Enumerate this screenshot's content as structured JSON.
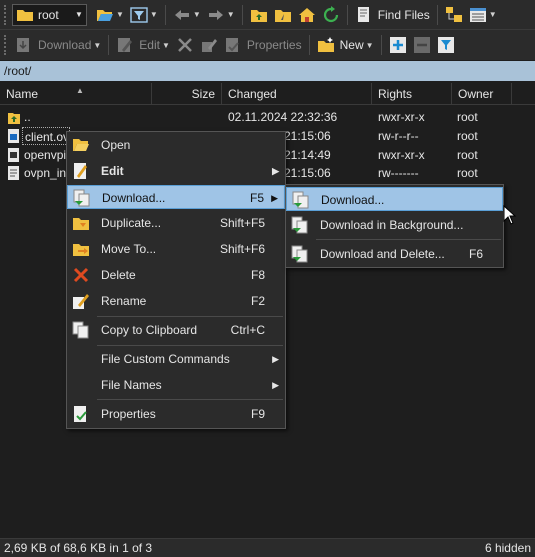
{
  "toolbar1": {
    "location": "root",
    "find_files": "Find Files"
  },
  "toolbar2": {
    "download": "Download",
    "edit": "Edit",
    "properties": "Properties",
    "new": "New"
  },
  "path": "/root/",
  "columns": {
    "name": "Name",
    "size": "Size",
    "changed": "Changed",
    "rights": "Rights",
    "owner": "Owner"
  },
  "files": [
    {
      "name": "..",
      "size": "",
      "changed": "02.11.2024 22:32:36",
      "rights": "rwxr-xr-x",
      "owner": "root"
    },
    {
      "name": "client.ov",
      "size": "",
      "changed": "21:15:06",
      "rights": "rw-r--r--",
      "owner": "root"
    },
    {
      "name": "openvpi",
      "size": "",
      "changed": "21:14:49",
      "rights": "rwxr-xr-x",
      "owner": "root"
    },
    {
      "name": "ovpn_in",
      "size": "",
      "changed": "21:15:06",
      "rights": "rw-------",
      "owner": "root"
    }
  ],
  "context_menu": {
    "open": "Open",
    "edit": "Edit",
    "download": "Download...",
    "download_shortcut": "F5",
    "duplicate": "Duplicate...",
    "duplicate_shortcut": "Shift+F5",
    "move": "Move To...",
    "move_shortcut": "Shift+F6",
    "delete": "Delete",
    "delete_shortcut": "F8",
    "rename": "Rename",
    "rename_shortcut": "F2",
    "copy_clipboard": "Copy to Clipboard",
    "copy_clipboard_shortcut": "Ctrl+C",
    "custom_commands": "File Custom Commands",
    "file_names": "File Names",
    "properties": "Properties",
    "properties_shortcut": "F9"
  },
  "submenu": {
    "download": "Download...",
    "download_background": "Download in Background...",
    "download_delete": "Download and Delete...",
    "download_delete_shortcut": "F6"
  },
  "status": {
    "left": "2,69 KB of 68,6 KB in 1 of 3",
    "right": "6 hidden"
  },
  "colors": {
    "path_bar": "#a9c2d8",
    "highlight": "#9fc4e6",
    "folder": "#f0c040"
  }
}
